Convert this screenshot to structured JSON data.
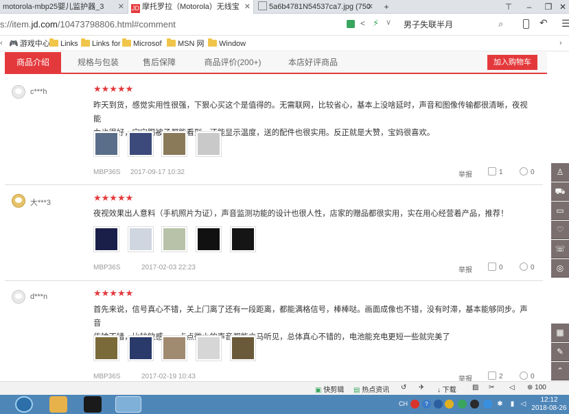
{
  "browser": {
    "tabs": [
      {
        "label": "motorola-mbp25婴儿监护器_3",
        "active": false
      },
      {
        "label": "摩托罗拉（Motorola）无线宝",
        "active": true,
        "favicon_text": "JD"
      },
      {
        "label": "5a6b4781N54537ca7.jpg (750",
        "active": false
      }
    ],
    "new_tab_symbol": "+",
    "url_prefix": "s://item.",
    "url_domain": "jd.com",
    "url_suffix": "/10473798806.html#comment",
    "search_text": "男子失联半月",
    "bookmarks": [
      {
        "label": "游戏中心",
        "type": "gamepad-icon"
      },
      {
        "label": "Links",
        "type": "folder-icon"
      },
      {
        "label": "Links for",
        "type": "folder-icon"
      },
      {
        "label": "Microsof",
        "type": "folder-icon"
      },
      {
        "label": "MSN 网",
        "type": "folder-icon"
      },
      {
        "label": "Window",
        "type": "folder-icon"
      }
    ]
  },
  "nav": {
    "tabs": [
      {
        "label": "商品介绍",
        "active": true
      },
      {
        "label": "规格与包装",
        "active": false
      },
      {
        "label": "售后保障",
        "active": false
      },
      {
        "label": "商品评价(200+)",
        "active": false
      },
      {
        "label": "本店好评商品",
        "active": false
      }
    ],
    "cart_button": "加入购物车"
  },
  "reviews": [
    {
      "user": "c***h",
      "avatar": "default",
      "stars": "★★★★★",
      "lines": [
        "昨天到货，感觉实用性很强，下狠心买这个是值得的。无需联网，比较省心，基本上没啥延时，声音和图像传输都很清晰，夜视能",
        "力也很好，宝宝踢被子都能看到，还能显示温度，送的配件也很实用。反正就是大赞，宝妈很喜欢。"
      ],
      "images": [
        "#5a6e8a",
        "#3b4a7a",
        "#8a7a5a",
        "#c9c9c9"
      ],
      "model": "MBP36S",
      "date": "2017-09-17 10:32",
      "report": "举报",
      "likes": "1",
      "comments": "0"
    },
    {
      "user": "大***3",
      "avatar": "gold",
      "stars": "★★★★★",
      "lines": [
        "夜视效果出人意料（手机照片为证），声音监测功能的设计也很人性，店家的赠品都很实用，实在用心经营着产品，推荐！"
      ],
      "images": [
        "#1a1f4a",
        "#cfd6e0",
        "#b8c2a8",
        "#111111",
        "#151515"
      ],
      "model": "MBP36S",
      "date": "2017-02-03 22:23",
      "report": "举报",
      "likes": "0",
      "comments": "0"
    },
    {
      "user": "d***n",
      "avatar": "default",
      "stars": "★★★★★",
      "lines": [
        "首先来说，信号真心不错，关上门离了还有一段距离，都能满格信号，棒棒哒。画面成像也不错，没有时滞，基本能够同步。声音",
        "传输不错，比较敏感，一点点微小的声音都能立马听见，总体真心不错的，电池能充电更短一些就完美了"
      ],
      "images": [
        "#7a6a3a",
        "#2a3a6a",
        "#a08a70",
        "#d6d6d6",
        "#6a5a3a"
      ],
      "model": "MBP36S",
      "date": "2017-02-19 10:43",
      "report": "举报",
      "likes": "2",
      "comments": "0"
    }
  ],
  "statusbar": {
    "items": [
      "快剪辑",
      "热点资讯",
      "下载",
      "100"
    ]
  },
  "taskbar": {
    "lang": "CH",
    "time": "12:12",
    "date": "2018-08-26"
  },
  "colors": {
    "jd_red": "#e4393c",
    "taskbar": "#4f86b8",
    "sidebar": "#7a6e6e"
  }
}
